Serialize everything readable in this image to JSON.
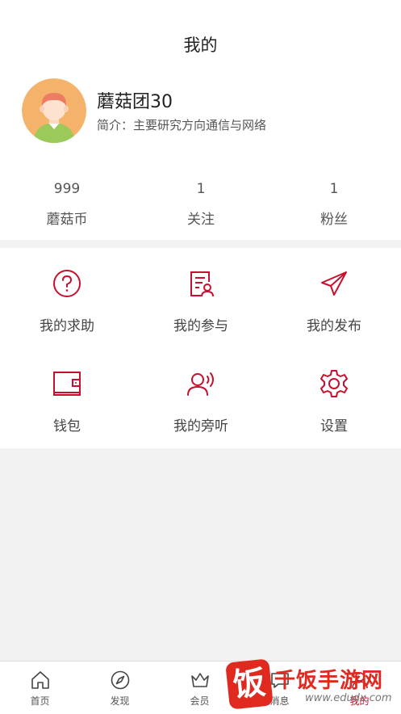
{
  "header": {
    "title": "我的"
  },
  "profile": {
    "name": "蘑菇团30",
    "bio": "简介：主要研究方向通信与网络"
  },
  "stats": [
    {
      "value": "999",
      "label": "蘑菇币"
    },
    {
      "value": "1",
      "label": "关注"
    },
    {
      "value": "1",
      "label": "粉丝"
    }
  ],
  "menu": [
    {
      "label": "我的求助",
      "icon": "question-circle-icon"
    },
    {
      "label": "我的参与",
      "icon": "document-user-icon"
    },
    {
      "label": "我的发布",
      "icon": "paper-plane-icon"
    },
    {
      "label": "钱包",
      "icon": "wallet-icon"
    },
    {
      "label": "我的旁听",
      "icon": "user-listen-icon"
    },
    {
      "label": "设置",
      "icon": "gear-icon"
    }
  ],
  "tabbar": [
    {
      "label": "首页",
      "icon": "home-icon"
    },
    {
      "label": "发现",
      "icon": "compass-icon"
    },
    {
      "label": "会员",
      "icon": "crown-icon"
    },
    {
      "label": "消息",
      "icon": "message-icon"
    },
    {
      "label": "我的",
      "icon": "profile-icon",
      "active": true
    }
  ],
  "watermark": {
    "char": "饭",
    "text": "千饭手游网",
    "url": "www.edudx.com"
  },
  "colors": {
    "accent": "#c8102e",
    "background": "#f2f2f2",
    "avatar_bg": "#f5b26a"
  }
}
